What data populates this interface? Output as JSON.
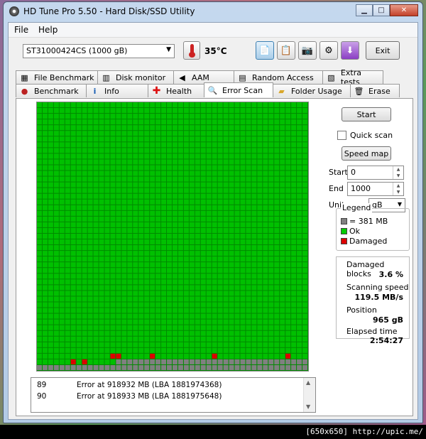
{
  "window": {
    "title": "HD Tune Pro 5.50 - Hard Disk/SSD Utility"
  },
  "menu": [
    "File",
    "Help"
  ],
  "toolbar": {
    "drive": "ST31000424CS (1000 gB)",
    "temperature": "35°C",
    "exit_label": "Exit"
  },
  "tabs_top": [
    "File Benchmark",
    "Disk monitor",
    "AAM",
    "Random Access",
    "Extra tests"
  ],
  "tabs_bottom": [
    "Benchmark",
    "Info",
    "Health",
    "Error Scan",
    "Folder Usage",
    "Erase"
  ],
  "selected_tab": "Error Scan",
  "controls": {
    "start_label": "Start",
    "quick_scan_label": "Quick scan",
    "speed_map_label": "Speed map",
    "start_field_label": "Start",
    "start_value": "0",
    "end_field_label": "End",
    "end_value": "1000",
    "unit_label": "Unit",
    "unit_value": "gB"
  },
  "legend": {
    "title": "Legend",
    "items": [
      {
        "label": "= 381 MB",
        "color": "#808080"
      },
      {
        "label": "Ok",
        "color": "#00cc00"
      },
      {
        "label": "Damaged",
        "color": "#dd0000"
      }
    ]
  },
  "stats": {
    "damaged_label": "Damaged blocks",
    "damaged_value": "3.6 %",
    "speed_label": "Scanning speed",
    "speed_value": "119.5 MB/s",
    "position_label": "Position",
    "position_value": "965 gB",
    "elapsed_label": "Elapsed time",
    "elapsed_value": "2:54:27"
  },
  "log": [
    {
      "num": "89",
      "text": "Error at 918932 MB (LBA 1881974368)"
    },
    {
      "num": "90",
      "text": "Error at 918933 MB (LBA 1881975648)"
    }
  ],
  "scan_grid": {
    "columns": 48,
    "rows": 47,
    "scanned_full_rows": 45,
    "last_row_scanned_columns": 14,
    "damaged_cells": [
      [
        44,
        13
      ],
      [
        44,
        14
      ],
      [
        45,
        6
      ],
      [
        45,
        8
      ],
      [
        44,
        20
      ],
      [
        44,
        31
      ],
      [
        44,
        44
      ]
    ],
    "colors": {
      "ok": "#00c000",
      "unscanned": "#808080",
      "damaged": "#dd0000",
      "gridline": "#008a00"
    }
  },
  "watermark": "[650x650] http://upic.me/"
}
